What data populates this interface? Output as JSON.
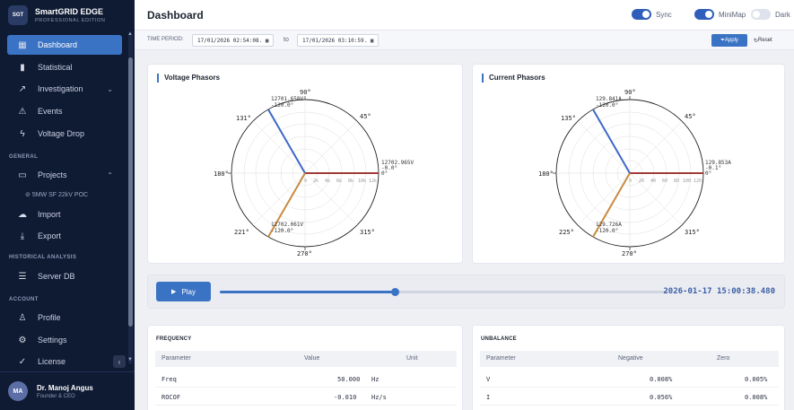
{
  "brand": {
    "logo": "SGT",
    "name": "SmartGRID EDGE",
    "subtitle": "PROFESSIONAL EDITION"
  },
  "sidebar": {
    "items": [
      {
        "label": "Dashboard",
        "icon": "grid-icon",
        "active": true
      },
      {
        "label": "Statistical",
        "icon": "bar-chart-icon"
      },
      {
        "label": "Investigation",
        "icon": "trend-icon"
      },
      {
        "label": "Events",
        "icon": "warning-icon"
      },
      {
        "label": "Voltage Drop",
        "icon": "bolt-icon"
      }
    ],
    "section_general": "GENERAL",
    "projects_label": "Projects",
    "project_sub": "5MW SF 22kV POC",
    "import_label": "Import",
    "export_label": "Export",
    "section_historical": "HISTORICAL ANALYSIS",
    "server_db_label": "Server DB",
    "section_account": "ACCOUNT",
    "profile_label": "Profile",
    "settings_label": "Settings",
    "license_label": "License"
  },
  "user": {
    "initials": "MA",
    "name": "Dr. Manoj Angus",
    "role": "Founder & CEO"
  },
  "header": {
    "title": "Dashboard",
    "toggles": [
      {
        "label": "Sync",
        "on": true
      },
      {
        "label": "MiniMap",
        "on": true
      },
      {
        "label": "Dark",
        "on": false
      }
    ]
  },
  "filter": {
    "label": "TIME PERIOD:",
    "from": "17/01/2026 02:54:08.",
    "to_label": "to",
    "to": "17/01/2026 03:10:59.",
    "apply": "Apply",
    "reset": "Reset"
  },
  "voltage": {
    "title": "Voltage Phasors",
    "deg_labels": {
      "d90": "90°",
      "d45": "45°",
      "d135": "131°",
      "d180": "180°",
      "d225": "221°",
      "d270": "270°",
      "d315": "315°"
    },
    "rings": [
      "0",
      "2k",
      "4k",
      "6k",
      "8k",
      "10k",
      "12k"
    ],
    "phasors": [
      {
        "mag": "12701.658V",
        "ang": "-120.0°",
        "color": "#3d68c8"
      },
      {
        "mag": "12702.965V",
        "ang": "-0.0°",
        "ang2": "0°",
        "color": "#a33a3a"
      },
      {
        "mag": "12702.061V",
        "ang": "-120.0°",
        "color": "#c98a3f"
      }
    ]
  },
  "current": {
    "title": "Current Phasors",
    "deg_labels": {
      "d90": "90°",
      "d45": "45°",
      "d135": "135°",
      "d180": "180°",
      "d225": "225°",
      "d270": "270°",
      "d315": "315°"
    },
    "rings": [
      "0",
      "20",
      "40",
      "60",
      "80",
      "100",
      "120"
    ],
    "phasors": [
      {
        "mag": "129.841A",
        "ang": "-120.0°",
        "color": "#3d68c8"
      },
      {
        "mag": "129.853A",
        "ang": "-0.1°",
        "ang2": "0°",
        "color": "#a33a3a"
      },
      {
        "mag": "129.726A",
        "ang": "-120.0°",
        "color": "#c98a3f"
      }
    ]
  },
  "playback": {
    "play_label": "Play",
    "progress": 0.39,
    "timestamp": "2026-01-17 15:00:38.480"
  },
  "frequency": {
    "title": "FREQUENCY",
    "headers": [
      "Parameter",
      "Value",
      "Unit"
    ],
    "rows": [
      {
        "param": "Freq",
        "value": "50.000",
        "unit": "Hz"
      },
      {
        "param": "ROCOF",
        "value": "-0.010",
        "unit": "Hz/s"
      }
    ]
  },
  "unbalance": {
    "title": "UNBALANCE",
    "headers": [
      "Parameter",
      "Negative",
      "Zero"
    ],
    "rows": [
      {
        "param": "V",
        "neg": "0.008%",
        "zero": "0.005%"
      },
      {
        "param": "I",
        "neg": "0.056%",
        "zero": "0.008%"
      }
    ]
  }
}
